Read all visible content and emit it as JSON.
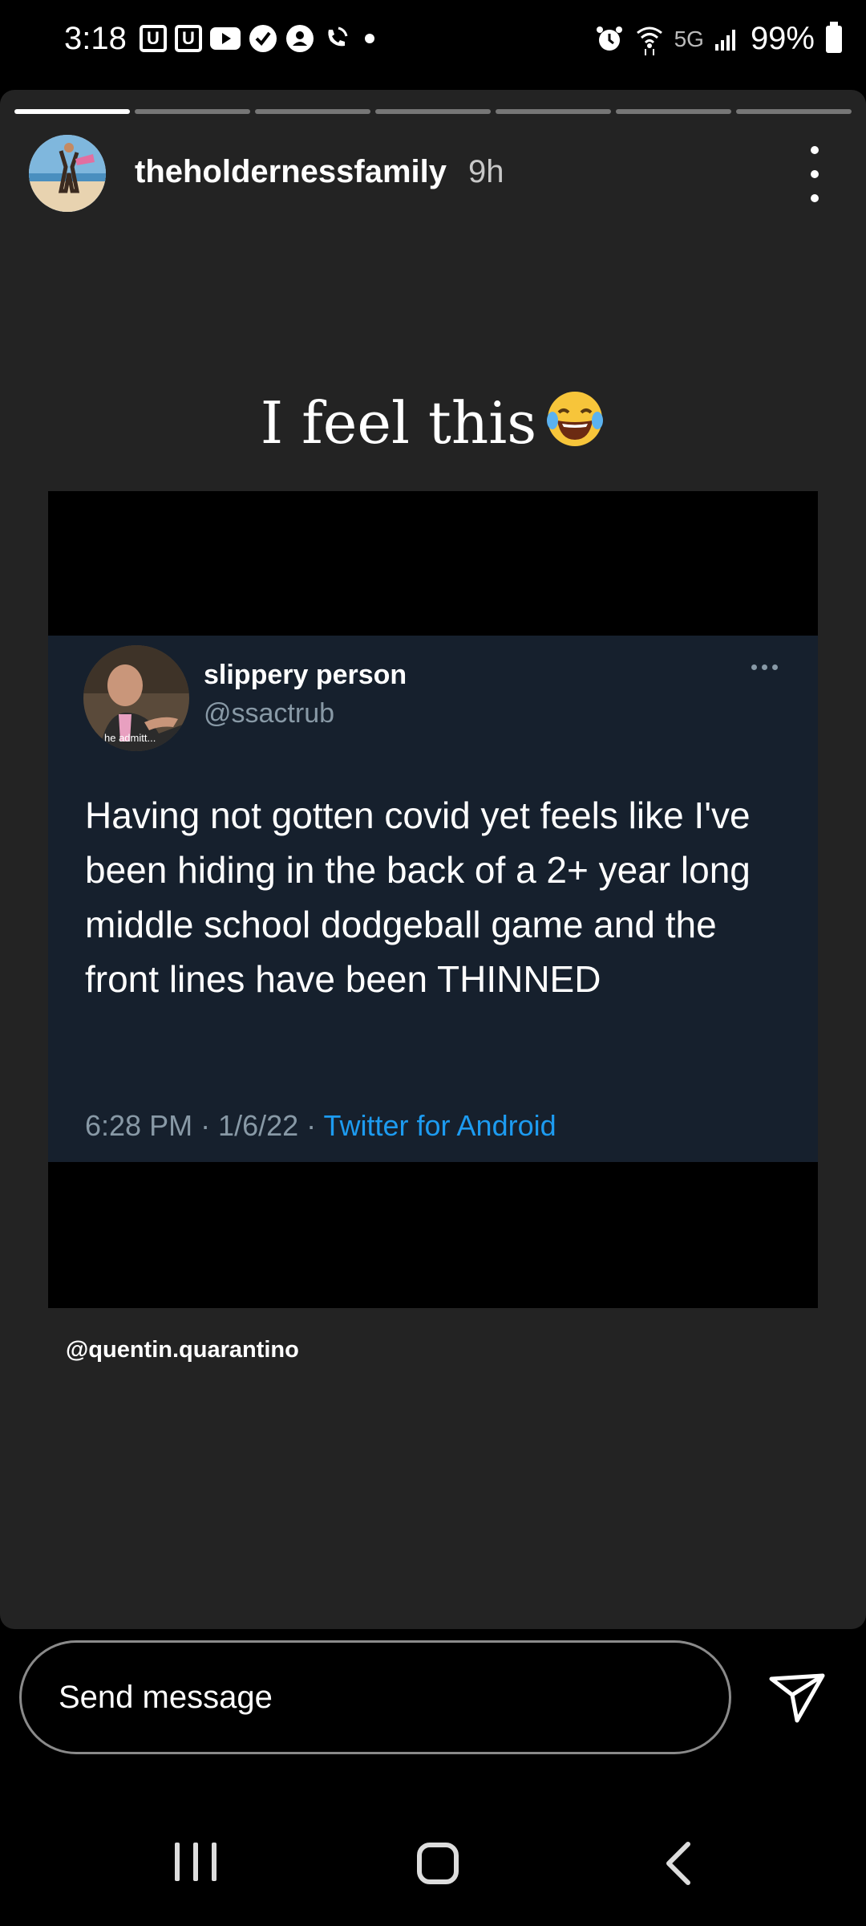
{
  "status_bar": {
    "time": "3:18",
    "left_icons": [
      "u-icon",
      "u-icon",
      "youtube-icon",
      "verified-icon",
      "account-icon",
      "wifi-call-icon",
      "dot-icon"
    ],
    "network": "5G",
    "battery": "99%",
    "right_icons": [
      "alarm-icon",
      "wifi-icon",
      "signal-icon",
      "battery-icon"
    ]
  },
  "story": {
    "segments_total": 7,
    "segments_viewed": 1,
    "username": "theholdernessfamily",
    "time_ago": "9h",
    "caption": "I feel this",
    "caption_emoji": "tears-of-joy-emoji",
    "tweet": {
      "name": "slippery person",
      "handle": "@ssactrub",
      "avatar_overlay_text": "he admitt...",
      "text": "Having not gotten covid yet feels like I've been hiding in the back of a 2+ year long middle school dodgeball game and the front lines have been THINNED",
      "timestamp": "6:28 PM · 1/6/22 · ",
      "source": "Twitter for Android"
    },
    "mention": "@quentin.quarantino"
  },
  "reply": {
    "placeholder": "Send message"
  },
  "colors": {
    "story_bg": "#232323",
    "tweet_bg": "#16202d",
    "twitter_blue": "#1d9bf0",
    "muted": "#8899a6"
  }
}
